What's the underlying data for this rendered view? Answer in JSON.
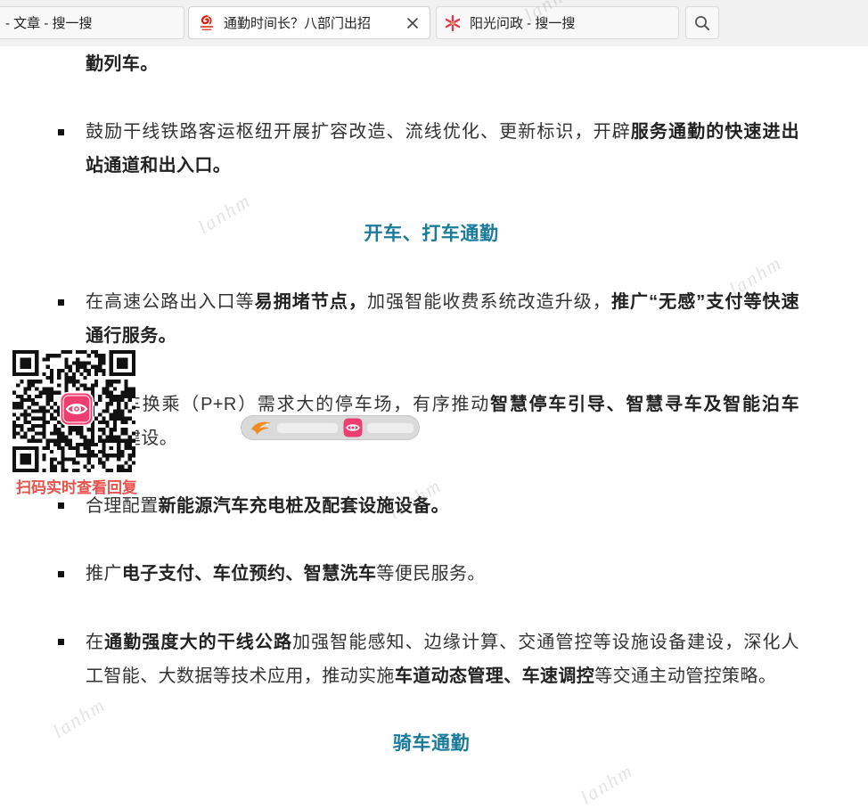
{
  "browser": {
    "tabs": [
      {
        "title": "- 文章 - 搜一搜",
        "active": false
      },
      {
        "title": "通勤时间长？八部门出招",
        "active": true,
        "favicon": "people-daily-logo-icon"
      },
      {
        "title": "阳光问政 - 搜一搜",
        "active": false,
        "favicon": "sunshine-pinwheel-icon"
      }
    ],
    "close_icon": "close-icon",
    "search_icon": "search-icon"
  },
  "article": {
    "continuation": [
      {
        "t": "勤列车。",
        "b": true
      }
    ],
    "items_rail": [
      {
        "lines": [
          [
            {
              "t": "鼓励干线铁路客运枢纽开展扩容改造、流线优化、更新标识，开辟",
              "b": false
            },
            {
              "t": "服务通勤的快速进出",
              "b": true
            }
          ],
          [
            {
              "t": "站通道和出入口。",
              "b": true
            }
          ]
        ]
      }
    ],
    "heading_drive": "开车、打车通勤",
    "items_drive": [
      {
        "lines": [
          [
            {
              "t": "在高速公路出入口等",
              "b": false
            },
            {
              "t": "易拥堵节点，",
              "b": true
            },
            {
              "t": "加强智能收费系统改造升级，",
              "b": false
            },
            {
              "t": "推广“无感”支付等快速",
              "b": true
            }
          ],
          [
            {
              "t": "通行服务。",
              "b": true
            }
          ]
        ]
      },
      {
        "lines": [
          [
            {
              "t": "车换乘（P+R）需求大的停车场，有序推动",
              "b": false
            },
            {
              "t": "智慧停车引导、智慧寻车及智能泊车",
              "b": true
            }
          ],
          [
            {
              "t": "建设。",
              "b": false
            }
          ]
        ]
      },
      {
        "lines": [
          [
            {
              "t": "合理配置",
              "b": false
            },
            {
              "t": "新能源汽车充电桩及配套设施设备。",
              "b": true
            }
          ]
        ]
      },
      {
        "lines": [
          [
            {
              "t": "推广",
              "b": false
            },
            {
              "t": "电子支付、车位预约、智慧洗车",
              "b": true
            },
            {
              "t": "等便民服务。",
              "b": false
            }
          ]
        ]
      },
      {
        "lines": [
          [
            {
              "t": "在",
              "b": false
            },
            {
              "t": "通勤强度大的干线公路",
              "b": true
            },
            {
              "t": "加强智能感知、边缘计算、交通管控等设施设备建设，深化人",
              "b": false
            }
          ],
          [
            {
              "t": "工智能、大数据等技术应用，推动实施",
              "b": false
            },
            {
              "t": "车道动态管理、车速调控",
              "b": true
            },
            {
              "t": "等交通主动管控策略。",
              "b": false
            }
          ]
        ]
      }
    ],
    "heading_ride": "骑车通勤"
  },
  "overlay": {
    "qr_caption": "扫码实时查看回复",
    "qr_logo_icon": "eye-icon",
    "badge_icons": [
      "news-bird-logo-icon",
      "eye-icon"
    ]
  },
  "watermark_text": "lanhm",
  "colors": {
    "heading": "#1a7b9c",
    "body_text": "#333333",
    "qr_caption": "#e8524b",
    "app_pink": "#ee3d70"
  }
}
